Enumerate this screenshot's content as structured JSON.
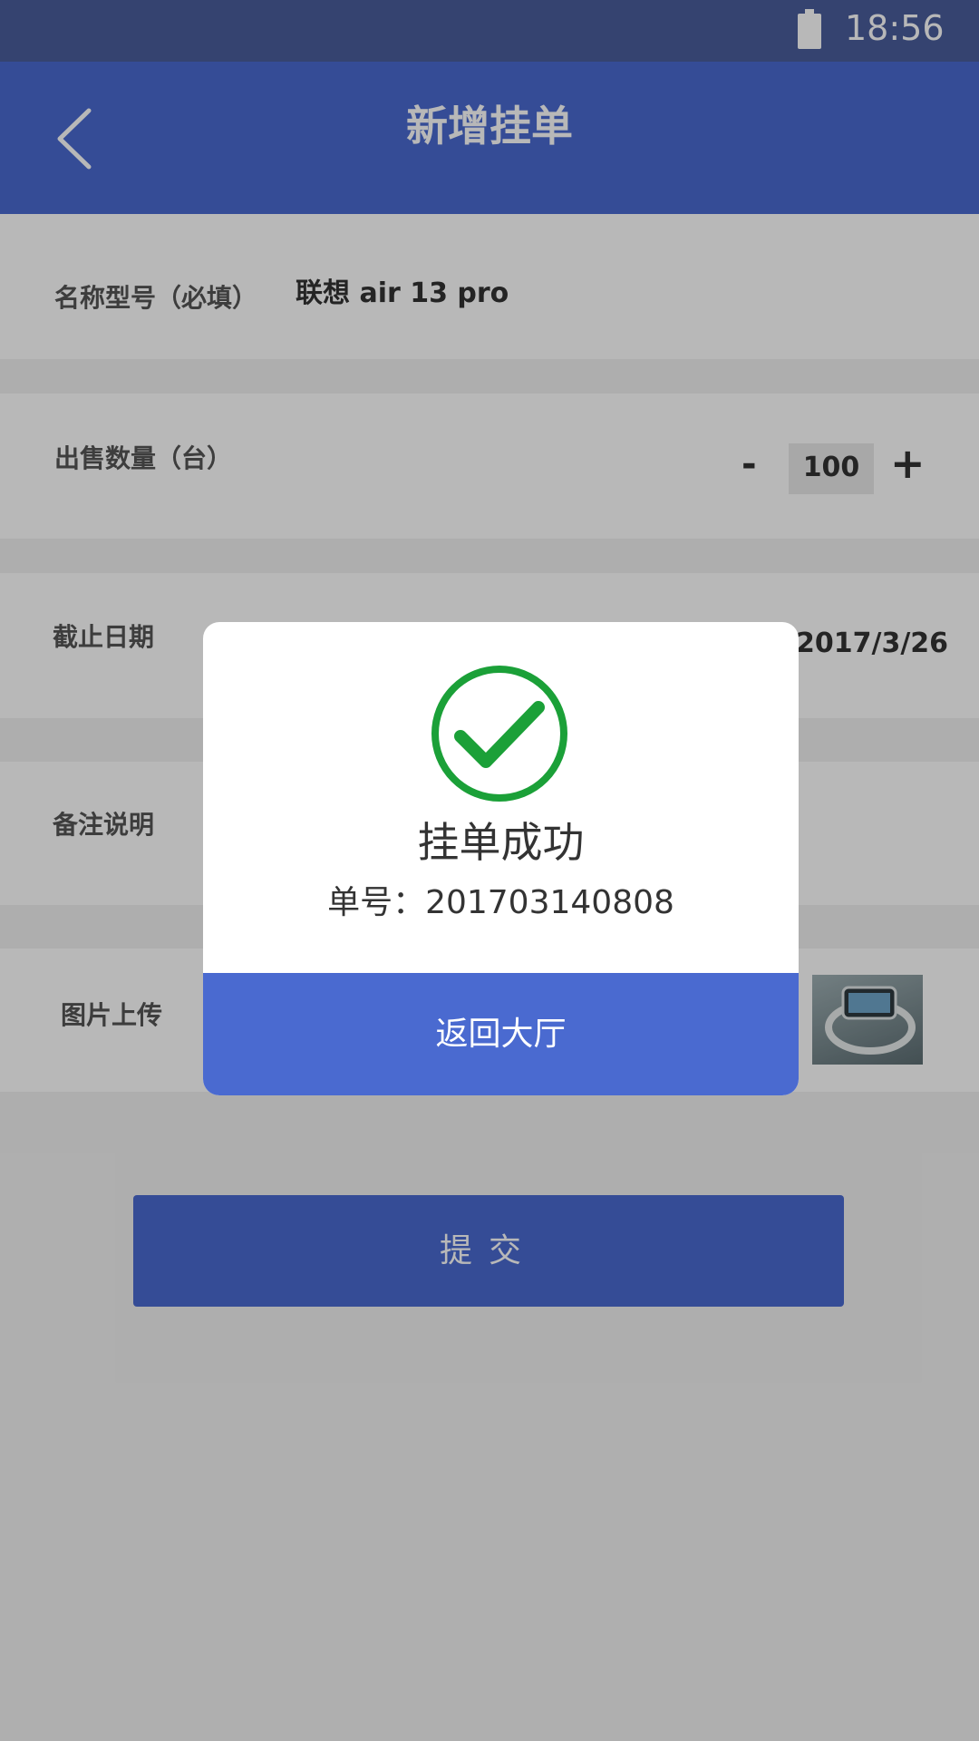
{
  "status_bar": {
    "time": "18:56",
    "battery_icon": "battery-icon"
  },
  "header": {
    "title": "新增挂单",
    "back_icon": "chevron-left-icon"
  },
  "form": {
    "name_label": "名称型号（必填）",
    "name_value": "联想 air 13 pro",
    "quantity_label": "出售数量（台）",
    "quantity_minus": "-",
    "quantity_value": "100",
    "quantity_plus": "+",
    "deadline_label": "截止日期",
    "deadline_value": "2017/3/26",
    "remark_label": "备注说明",
    "image_label": "图片上传",
    "thumbnail_icon": "product-thumbnail"
  },
  "submit_label": "提交",
  "dialog": {
    "success_icon": "check-circle-icon",
    "title": "挂单成功",
    "order_number": "单号：201703140808",
    "button_label": "返回大厅"
  },
  "colors": {
    "primary": "#4a6ad0",
    "success": "#1ba038",
    "background": "#f2f2f2",
    "overlay": "rgba(0,0,0,0.28)"
  }
}
